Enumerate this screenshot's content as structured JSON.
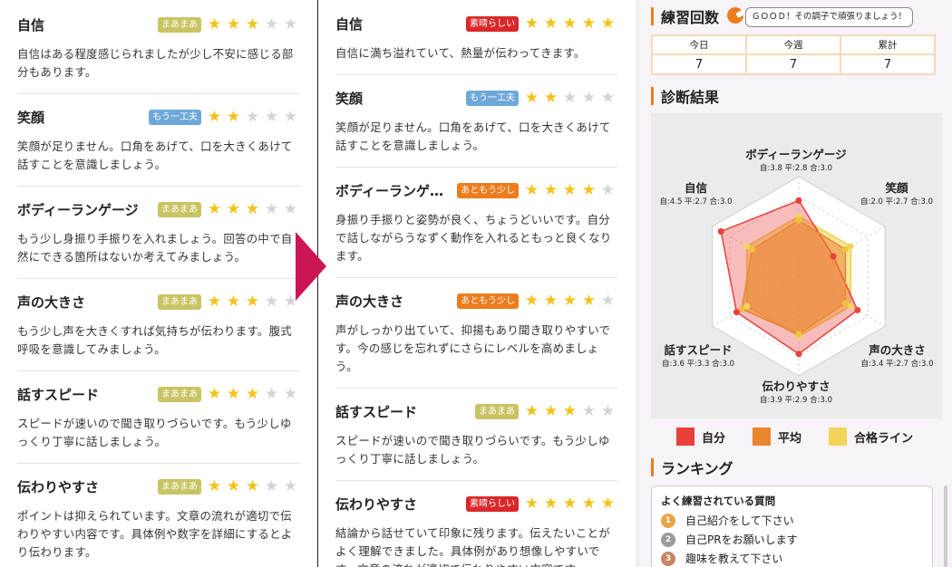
{
  "left": {
    "items": [
      {
        "title": "自信",
        "badge": "まあまあ",
        "badge_color": "#c9c463",
        "stars": 3,
        "text": "自信はある程度感じられましたが少し不安に感じる部分もあります。"
      },
      {
        "title": "笑顔",
        "badge": "もう一工夫",
        "badge_color": "#6ea8d9",
        "stars": 2,
        "text": "笑顔が足りません。口角をあげて、口を大きくあけて話すことを意識しましょう。"
      },
      {
        "title": "ボディーランゲージ",
        "badge": "まあまあ",
        "badge_color": "#c9c463",
        "stars": 3,
        "text": "もう少し身振り手振りを入れましょう。回答の中で自然にできる箇所はないか考えてみましょう。"
      },
      {
        "title": "声の大きさ",
        "badge": "まあまあ",
        "badge_color": "#c9c463",
        "stars": 3,
        "text": "もう少し声を大きくすれば気持ちが伝わります。腹式呼吸を意識してみましょう。"
      },
      {
        "title": "話すスピード",
        "badge": "まあまあ",
        "badge_color": "#c9c463",
        "stars": 3,
        "text": "スピードが速いので聞き取りづらいです。もう少しゆっくり丁寧に話しましょう。"
      },
      {
        "title": "伝わりやすさ",
        "badge": "まあまあ",
        "badge_color": "#c9c463",
        "stars": 3,
        "text": "ポイントは抑えられています。文章の流れが適切で伝わりやすい内容です。具体例や数字を詳細にするとより伝わります。"
      }
    ]
  },
  "mid": {
    "items": [
      {
        "title": "自信",
        "badge": "素晴らしい",
        "badge_color": "#d9282b",
        "stars": 5,
        "text": "自信に満ち溢れていて、熱量が伝わってきます。"
      },
      {
        "title": "笑顔",
        "badge": "もう一工夫",
        "badge_color": "#6ea8d9",
        "stars": 2,
        "text": "笑顔が足りません。口角をあげて、口を大きくあけて話すことを意識しましょう。"
      },
      {
        "title": "ボディーランゲ…",
        "badge": "あともう少し",
        "badge_color": "#ec7c1c",
        "stars": 4,
        "text": "身振り手振りと姿勢が良く、ちょうどいいです。自分で話しながらうなずく動作を入れるともっと良くなります。"
      },
      {
        "title": "声の大きさ",
        "badge": "あともう少し",
        "badge_color": "#ec7c1c",
        "stars": 4,
        "text": "声がしっかり出ていて、抑揚もあり聞き取りやすいです。今の感じを忘れずにさらにレベルを高めましょう。"
      },
      {
        "title": "話すスピード",
        "badge": "まあまあ",
        "badge_color": "#c9c463",
        "stars": 3,
        "text": "スピードが速いので聞き取りづらいです。もう少しゆっくり丁寧に話しましょう。"
      },
      {
        "title": "伝わりやすさ",
        "badge": "素晴らしい",
        "badge_color": "#d9282b",
        "stars": 5,
        "text": "結論から話せていて印象に残ります。伝えたいことがよく理解できました。具体例があり想像しやすいです。文章の流れが適切で伝わりやすい内容です。"
      }
    ]
  },
  "practice": {
    "title": "練習回数",
    "message": "ＧＯＯＤ！その調子で頑張りましょう！",
    "headers": [
      "今日",
      "今週",
      "累計"
    ],
    "values": [
      "7",
      "7",
      "7"
    ]
  },
  "diagnosis": {
    "title": "診断結果",
    "axes": [
      {
        "name": "ボディーランゲージ",
        "values": "自:3.8 平:2.8 合:3.0"
      },
      {
        "name": "笑顔",
        "values": "自:2.0 平:2.7 合:3.0"
      },
      {
        "name": "声の大きさ",
        "values": "自:3.4 平:2.7 合:3.0"
      },
      {
        "name": "伝わりやすさ",
        "values": "自:3.9 平:2.9 合:3.0"
      },
      {
        "name": "話すスピード",
        "values": "自:3.6 平:3.3 合:3.0"
      },
      {
        "name": "自信",
        "values": "自:4.5 平:2.7 合:3.0"
      }
    ],
    "scores": {
      "self": [
        3.8,
        2.0,
        3.4,
        3.9,
        3.6,
        4.5
      ],
      "average": [
        2.8,
        2.7,
        2.7,
        2.9,
        3.3,
        2.7
      ],
      "pass": [
        3.0,
        3.0,
        3.0,
        3.0,
        3.0,
        3.0
      ]
    },
    "max": 5,
    "legend": [
      {
        "label": "自分",
        "color": "#e8403b"
      },
      {
        "label": "平均",
        "color": "#e9862e"
      },
      {
        "label": "合格ライン",
        "color": "#f3d45a"
      }
    ]
  },
  "ranking": {
    "title": "ランキング",
    "box_title": "よく練習されている質問",
    "items": [
      {
        "rank": "1",
        "label": "自己紹介をして下さい",
        "color": "#e8a44a"
      },
      {
        "rank": "2",
        "label": "自己PRをお願いします",
        "color": "#9a9a9a"
      },
      {
        "rank": "3",
        "label": "趣味を教えて下さい",
        "color": "#c98462"
      }
    ]
  }
}
